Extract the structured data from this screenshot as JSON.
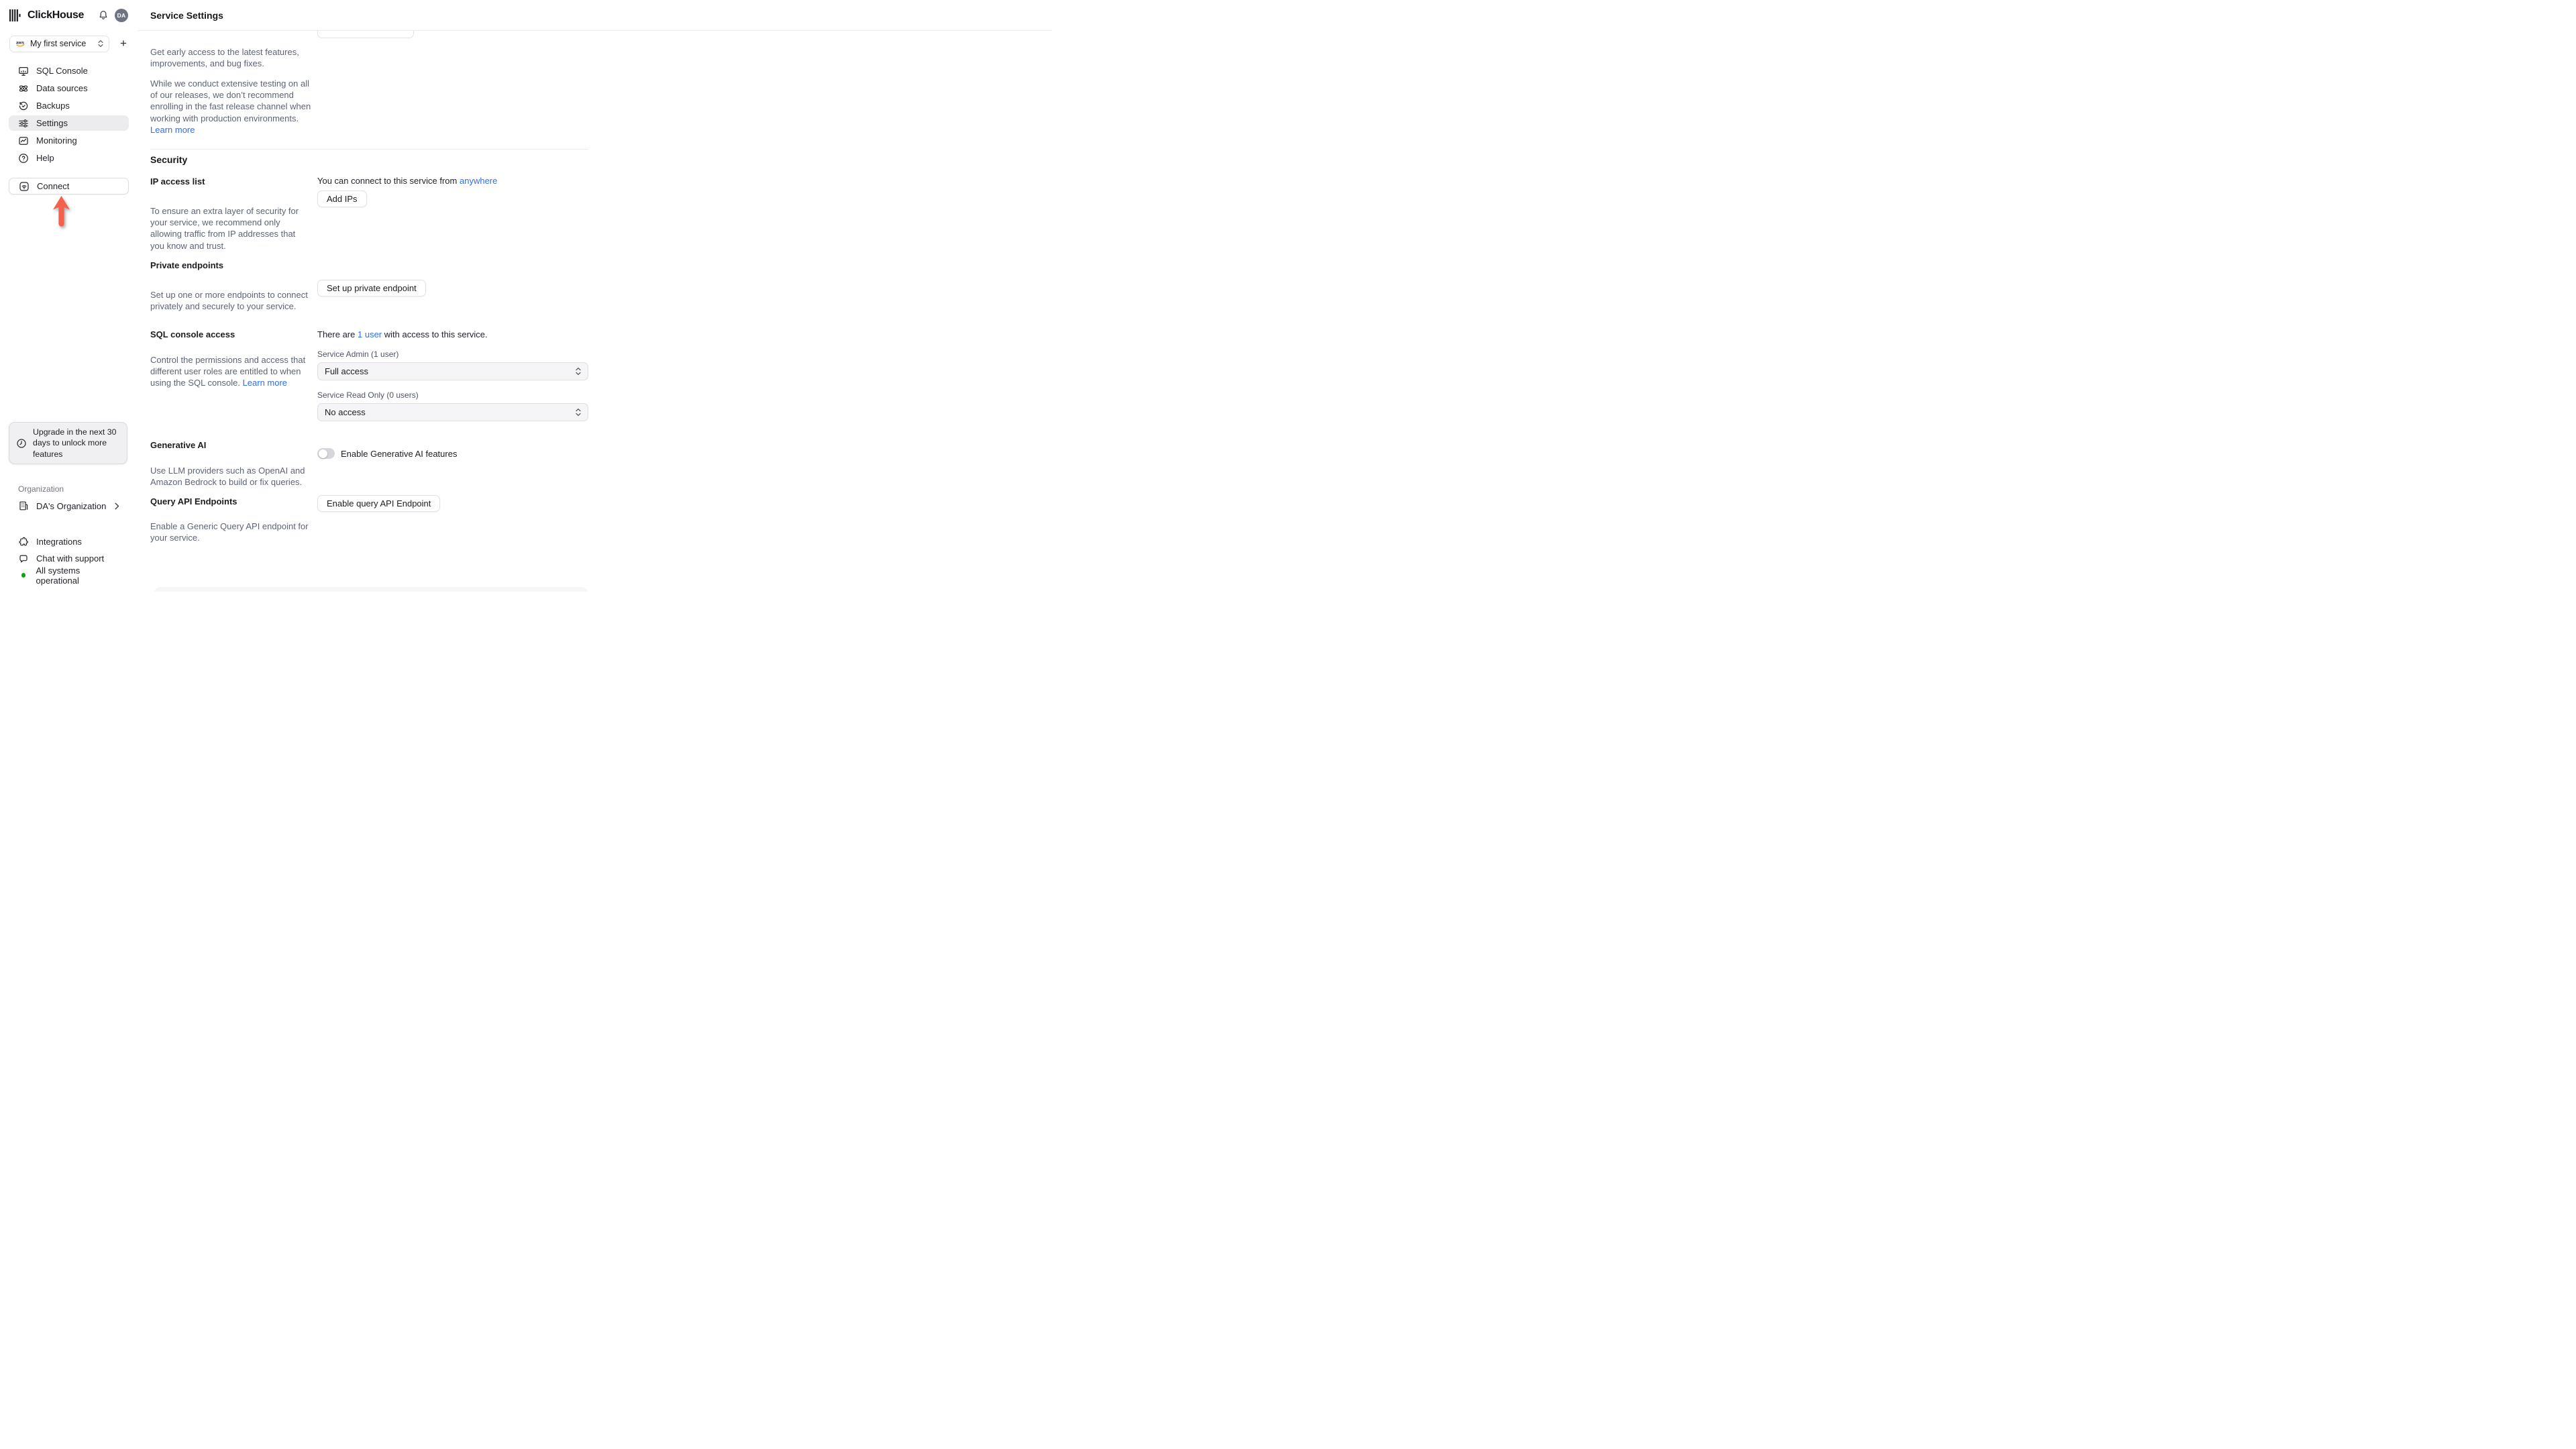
{
  "app": {
    "brand": "ClickHouse",
    "avatar_initials": "DA"
  },
  "colors": {
    "link": "#2e6ef5",
    "arrow_red": "#f4614d",
    "status_green": "#12a312",
    "aws_orange": "#f79400"
  },
  "icons": [
    "clickhouse-logo-bars",
    "bell-icon",
    "aws-icon",
    "updown-chevron-icon",
    "plus-icon",
    "sql-console-icon",
    "data-sources-icon",
    "backups-icon",
    "settings-icon",
    "monitoring-icon",
    "help-icon",
    "connect-icon",
    "red-arrow-annotation",
    "clock-icon",
    "building-icon",
    "chevron-right-icon",
    "puzzle-icon",
    "chat-bubble-icon",
    "green-status-dot"
  ],
  "sidebar": {
    "service_selector": {
      "label": "My first service",
      "provider": "aws"
    },
    "plus_label": "+",
    "items": [
      {
        "label": "SQL Console"
      },
      {
        "label": "Data sources"
      },
      {
        "label": "Backups"
      },
      {
        "label": "Settings",
        "selected": true
      },
      {
        "label": "Monitoring"
      },
      {
        "label": "Help"
      }
    ],
    "connect_label": "Connect",
    "upgrade_notice": "Upgrade in the next 30 days to unlock more features",
    "organization_label": "Organization",
    "organization_name": "DA's Organization",
    "footer_items": [
      {
        "label": "Integrations"
      },
      {
        "label": "Chat with support"
      }
    ],
    "status_text": "All systems operational"
  },
  "header": {
    "title": "Service Settings"
  },
  "sections": {
    "release": {
      "para1": "Get early access to the latest features, improvements, and bug fixes.",
      "para2": "While we conduct extensive testing on all of our releases, we don’t recommend enrolling in the fast release channel when working with production environments.",
      "learn_more": "Learn more"
    },
    "security": {
      "title": "Security"
    },
    "ip_access": {
      "title": "IP access list",
      "description": "To ensure an extra layer of security for your service, we recommend only allowing traffic from IP addresses that you know and trust.",
      "status_prefix": "You can connect to this service from",
      "status_link": "anywhere",
      "button": "Add IPs"
    },
    "private_endpoints": {
      "title": "Private endpoints",
      "description": "Set up one or more endpoints to connect privately and securely to your service.",
      "button": "Set up private endpoint"
    },
    "sql_access": {
      "title": "SQL console access",
      "description": "Control the permissions and access that different user roles are entitled to when using the SQL console.",
      "learn_more": "Learn more",
      "status_prefix": "There are",
      "status_link": "1 user",
      "status_suffix": "with access to this service.",
      "admin_label": "Service Admin (1 user)",
      "admin_value": "Full access",
      "readonly_label": "Service Read Only (0 users)",
      "readonly_value": "No access"
    },
    "generative_ai": {
      "title": "Generative AI",
      "description": "Use LLM providers such as OpenAI and Amazon Bedrock to build or fix queries.",
      "toggle_label": "Enable Generative AI features",
      "enabled": false
    },
    "query_api": {
      "title": "Query API Endpoints",
      "description": "Enable a Generic Query API endpoint for your service.",
      "button": "Enable query API Endpoint"
    }
  }
}
